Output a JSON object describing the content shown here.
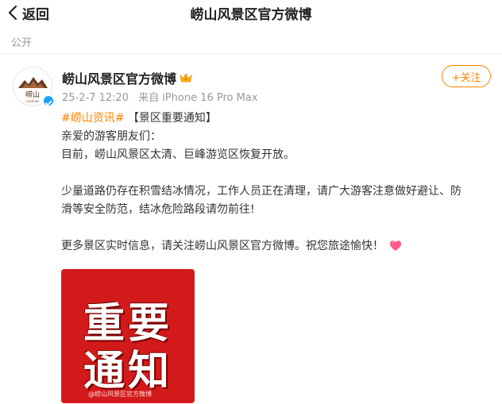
{
  "header": {
    "back_label": "返回",
    "title": "崂山风景区官方微博"
  },
  "visibility": "公开",
  "post": {
    "author": "崂山风景区官方微博",
    "avatar_text": "崂山",
    "avatar_subtext": "LaoShan",
    "time": "25-2-7 12:20",
    "source": "来自 iPhone 16 Pro Max",
    "follow_label": "+关注",
    "hashtag": "#崂山资讯#",
    "headline": "【景区重要通知】",
    "line1": "亲爱的游客朋友们：",
    "line2": "目前，崂山风景区太清、巨峰游览区恢复开放。",
    "line3": "少量道路仍存在积雪结冰情况，工作人员正在清理，请广大游客注意做好避让、防",
    "line4": "滑等安全防范，结冰危险路段请勿前往!",
    "line5": "更多景区实时信息，请关注崂山风景区官方微博。祝您旅途愉快！",
    "image": {
      "line1": "重要",
      "line2": "通知",
      "watermark": "@崂山风景区官方微博"
    }
  },
  "colors": {
    "accent": "#ff8200",
    "verified": "#1da1f2",
    "notice_bg": "#d21a1a"
  }
}
